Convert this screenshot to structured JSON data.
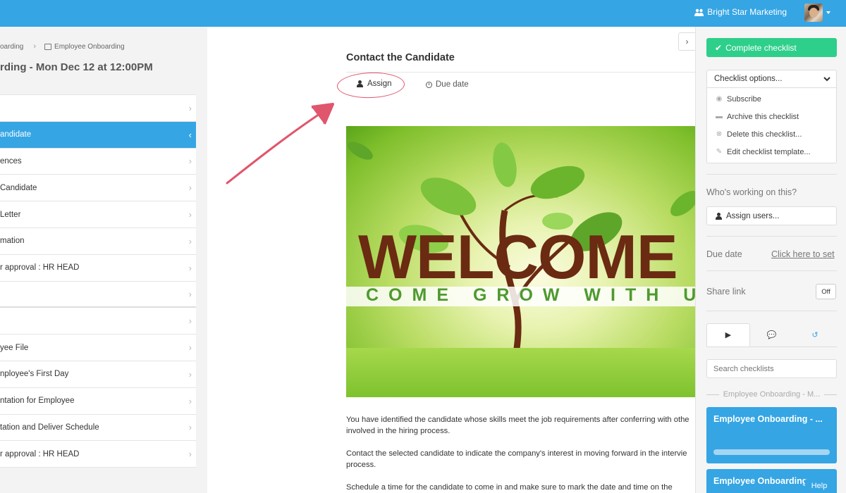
{
  "header": {
    "org_name": "Bright Star Marketing"
  },
  "breadcrumb": {
    "parent": "oarding",
    "current": "Employee Onboarding"
  },
  "checklist_title": "rding - Mon Dec 12 at 12:00PM",
  "tasks": [
    {
      "label": ""
    },
    {
      "label": "andidate"
    },
    {
      "label": "ences"
    },
    {
      "label": "Candidate"
    },
    {
      "label": "Letter"
    },
    {
      "label": "mation"
    },
    {
      "label": "r approval : HR HEAD"
    },
    {
      "label": ""
    },
    {
      "label": ""
    },
    {
      "label": "yee File"
    },
    {
      "label": "nployee's First Day"
    },
    {
      "label": "ntation for Employee"
    },
    {
      "label": "tation and Deliver Schedule"
    },
    {
      "label": "r approval : HR HEAD"
    }
  ],
  "task_detail": {
    "title": "Contact the Candidate",
    "assign_label": "Assign",
    "due_date_label": "Due date",
    "banner": {
      "headline": "WELCOME",
      "tagline": "COME GROW WITH US"
    },
    "paragraphs": [
      "You have identified the candidate whose skills meet the job requirements after conferring with othe",
      "involved in the hiring process.",
      "Contact the selected candidate to indicate the company's interest in moving forward in the intervie",
      "process.",
      "Schedule a time for the candidate to come in and make sure to mark the date and time on the"
    ]
  },
  "sidebar": {
    "complete_label": "Complete checklist",
    "options_label": "Checklist options...",
    "options": [
      {
        "label": "Subscribe",
        "icon": "eye-icon"
      },
      {
        "label": "Archive this checklist",
        "icon": "archive-icon"
      },
      {
        "label": "Delete this checklist...",
        "icon": "delete-icon"
      },
      {
        "label": "Edit checklist template...",
        "icon": "pencil-icon"
      }
    ],
    "working_label": "Who's working on this?",
    "assign_users_label": "Assign users...",
    "due_date_label": "Due date",
    "due_date_link": "Click here to set",
    "share_label": "Share link",
    "share_toggle": "Off",
    "search_placeholder": "Search checklists",
    "group_label": "Employee Onboarding - M...",
    "cards": [
      {
        "title": "Employee Onboarding - ..."
      },
      {
        "title": "Employee Onboarding"
      }
    ],
    "help_label": "Help"
  },
  "colors": {
    "accent": "#35a5e4",
    "success": "#2ecf8a",
    "annotation": "#e0566c"
  }
}
